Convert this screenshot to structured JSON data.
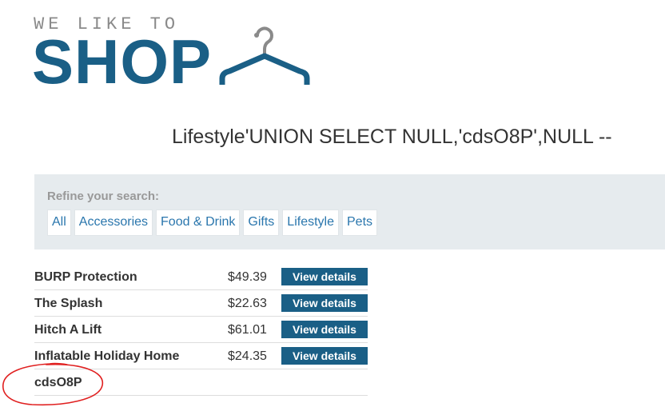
{
  "logo": {
    "tagline": "WE LIKE TO",
    "name": "SHOP"
  },
  "heading": "Lifestyle'UNION SELECT NULL,'cdsO8P',NULL --",
  "filter": {
    "title": "Refine your search:",
    "categories": [
      "All",
      "Accessories",
      "Food & Drink",
      "Gifts",
      "Lifestyle",
      "Pets"
    ]
  },
  "products": [
    {
      "name": "BURP Protection",
      "price": "$49.39",
      "button": "View details"
    },
    {
      "name": "The Splash",
      "price": "$22.63",
      "button": "View details"
    },
    {
      "name": "Hitch A Lift",
      "price": "$61.01",
      "button": "View details"
    },
    {
      "name": "Inflatable Holiday Home",
      "price": "$24.35",
      "button": "View details"
    },
    {
      "name": "cdsO8P",
      "price": "",
      "button": ""
    }
  ],
  "colors": {
    "brand": "#1a5f86",
    "link": "#2a76ad",
    "panel": "#e6ebee",
    "annotation": "#e02020"
  },
  "icons": [
    "hanger-icon"
  ]
}
